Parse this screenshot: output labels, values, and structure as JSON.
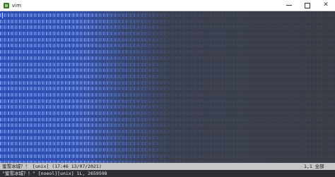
{
  "window": {
    "title": "vim",
    "app_icon": "vim-icon"
  },
  "titlebar_buttons": {
    "minimize": "minimize-icon",
    "maximize": "maximize-icon",
    "close_glyph": "✕"
  },
  "editor": {
    "line_count": 26,
    "line_sample": "<200b><202c><202a><200b><200e><200e><200e><200b><200e><200e><200b><200e><200e><200e><200e>",
    "colors": {
      "background_left": "#2d4db3",
      "background_right": "#3a3c43",
      "text": "#7fb0ff"
    }
  },
  "statusline": {
    "left": "蜜雪冰城？！ [unix] (17:46 13/07/2021)",
    "right": "1,1 全部"
  },
  "cmdline": {
    "text": "\"蜜雪冰城？！\" [noeol][unix] 1L, 2659598"
  }
}
